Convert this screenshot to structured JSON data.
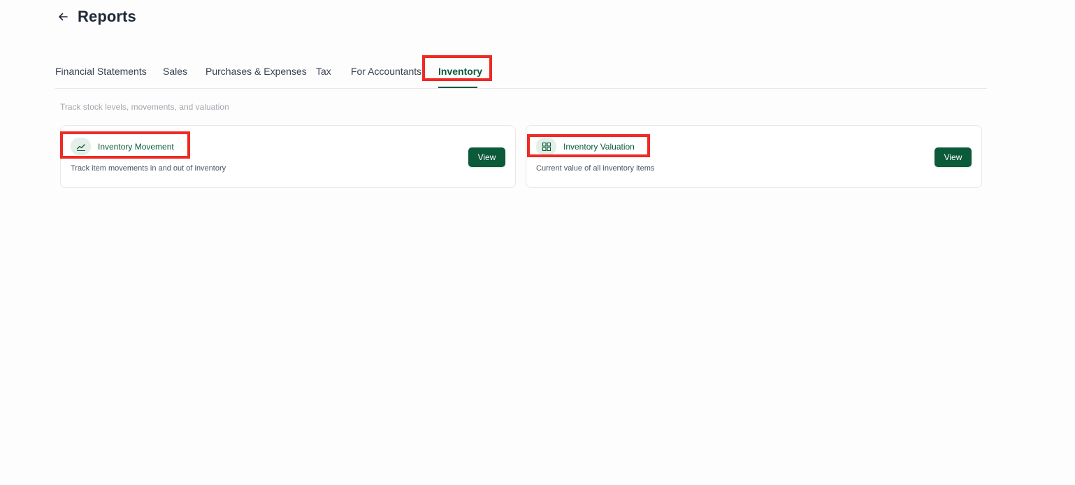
{
  "header": {
    "title": "Reports",
    "back_icon": "arrow-left-icon"
  },
  "tabs": [
    {
      "label": "Financial Statements",
      "active": false
    },
    {
      "label": "Sales",
      "active": false
    },
    {
      "label": "Purchases & Expenses",
      "active": false
    },
    {
      "label": "Tax",
      "active": false
    },
    {
      "label": "For Accountants",
      "active": false
    },
    {
      "label": "Inventory",
      "active": true
    }
  ],
  "section": {
    "subtitle": "Track stock levels, movements, and valuation"
  },
  "cards": [
    {
      "title": "Inventory Movement",
      "description": "Track item movements in and out of inventory",
      "icon": "trend-line-icon",
      "button": "View"
    },
    {
      "title": "Inventory Valuation",
      "description": "Current value of all inventory items",
      "icon": "grid-icon",
      "button": "View"
    }
  ],
  "colors": {
    "accent": "#0b5a3a",
    "highlight": "#ee2a24",
    "icon_bg": "#e3efe8"
  }
}
